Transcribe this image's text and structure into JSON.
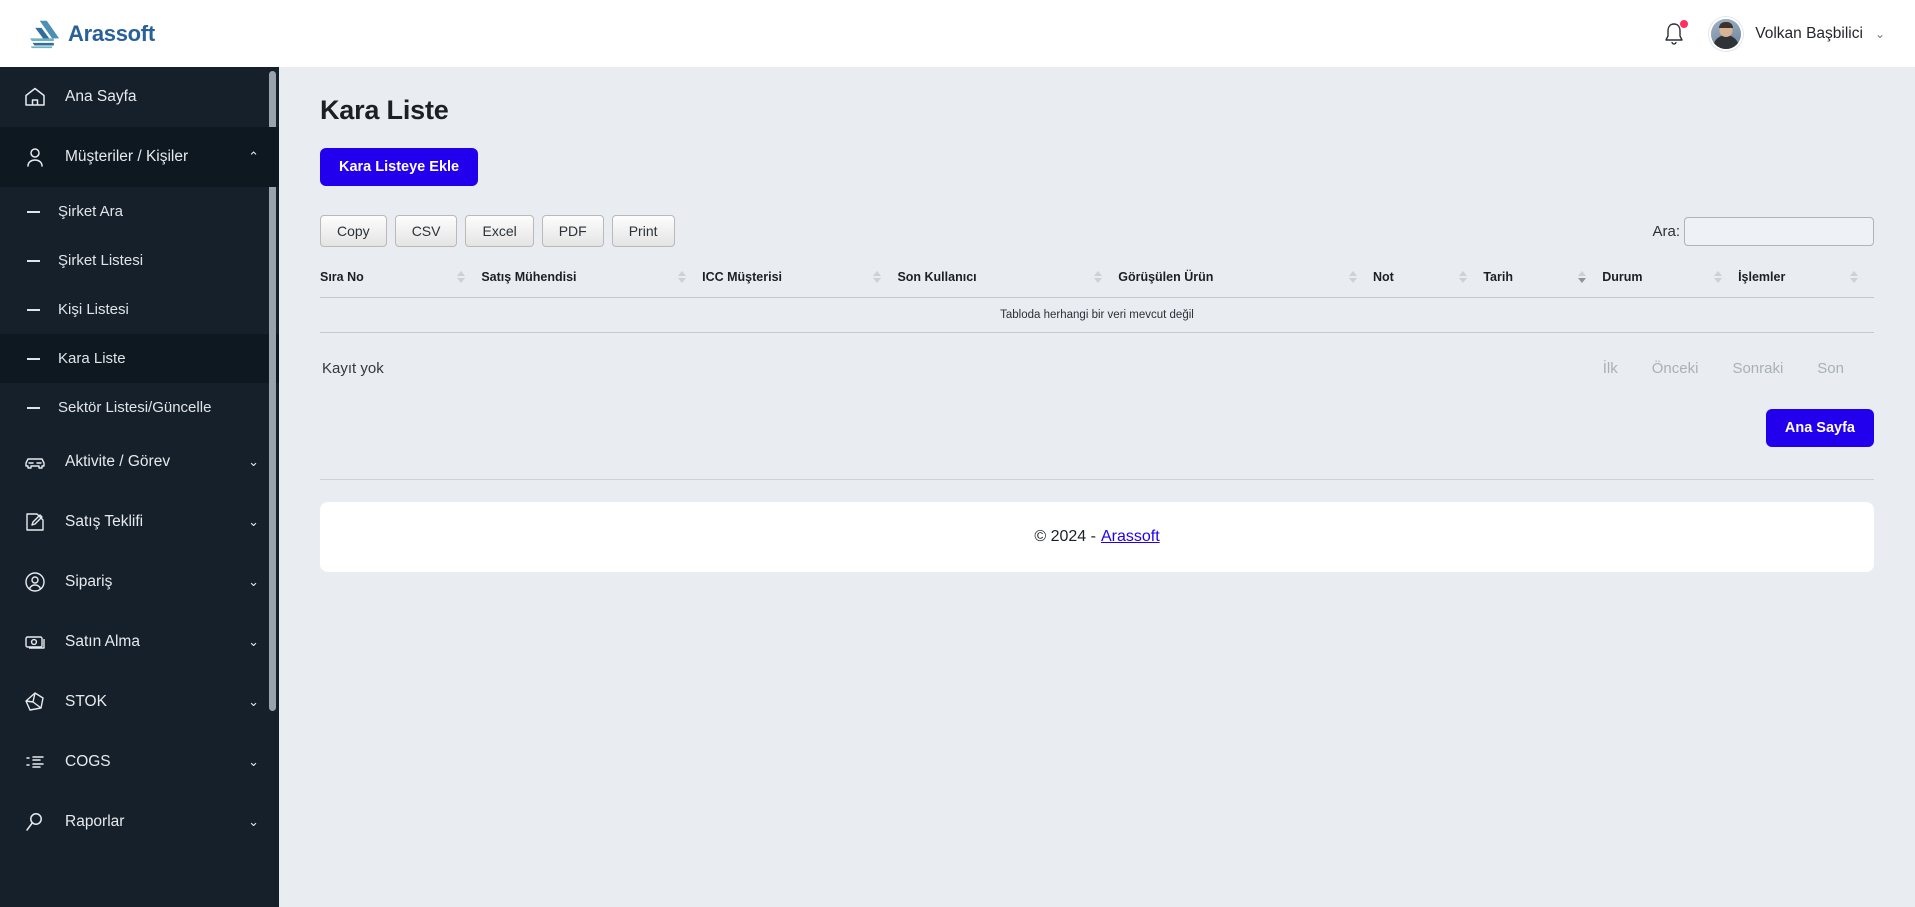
{
  "app": {
    "brand": "Arassoft",
    "accent_blue": "#2200ee",
    "sidebar_bg": "#16202a"
  },
  "topbar": {
    "notification_label": "Bildirimler",
    "user_name": "Volkan Başbilici",
    "user_chevron": "⌄"
  },
  "sidebar": {
    "items": [
      {
        "label": "Ana Sayfa",
        "icon": "home-icon",
        "chevron": "",
        "type": "link"
      },
      {
        "label": "Müşteriler / Kişiler",
        "icon": "user-icon",
        "chevron": "⌃",
        "type": "group",
        "open": true
      },
      {
        "label": "Aktivite / Görev",
        "icon": "car-icon",
        "chevron": "⌄",
        "type": "group",
        "open": false
      },
      {
        "label": "Satış Teklifi",
        "icon": "edit-square-icon",
        "chevron": "⌄",
        "type": "group",
        "open": false
      },
      {
        "label": "Sipariş",
        "icon": "user-circle-icon",
        "chevron": "⌄",
        "type": "group",
        "open": false
      },
      {
        "label": "Satın Alma",
        "icon": "banknote-icon",
        "chevron": "⌄",
        "type": "group",
        "open": false
      },
      {
        "label": "STOK",
        "icon": "cube-icon",
        "chevron": "⌄",
        "type": "group",
        "open": false
      },
      {
        "label": "COGS",
        "icon": "list-icon",
        "chevron": "⌄",
        "type": "group",
        "open": false
      },
      {
        "label": "Raporlar",
        "icon": "magnifier-icon",
        "chevron": "⌄",
        "type": "group",
        "open": false
      }
    ],
    "submenu": [
      {
        "label": "Şirket Ara",
        "active": false
      },
      {
        "label": "Şirket Listesi",
        "active": false
      },
      {
        "label": "Kişi Listesi",
        "active": false
      },
      {
        "label": "Kara Liste",
        "active": true
      },
      {
        "label": "Sektör Listesi/Güncelle",
        "active": false
      }
    ]
  },
  "main": {
    "page_title": "Kara Liste",
    "add_button": "Kara Listeye Ekle",
    "home_button": "Ana Sayfa"
  },
  "datatable": {
    "export_buttons": [
      "Copy",
      "CSV",
      "Excel",
      "PDF",
      "Print"
    ],
    "search_label": "Ara:",
    "search_value": "",
    "search_placeholder": "",
    "columns": [
      {
        "label": "Sıra No",
        "sort": "none"
      },
      {
        "label": "Satış Mühendisi",
        "sort": "none"
      },
      {
        "label": "ICC Müşterisi",
        "sort": "none"
      },
      {
        "label": "Son Kullanıcı",
        "sort": "none"
      },
      {
        "label": "Görüşülen Ürün",
        "sort": "none"
      },
      {
        "label": "Not",
        "sort": "none"
      },
      {
        "label": "Tarih",
        "sort": "desc"
      },
      {
        "label": "Durum",
        "sort": "none"
      },
      {
        "label": "İşlemler",
        "sort": "none"
      }
    ],
    "rows": [],
    "empty_message": "Tabloda herhangi bir veri mevcut değil",
    "info_text": "Kayıt yok",
    "pagination": [
      {
        "label": "İlk",
        "disabled": true
      },
      {
        "label": "Önceki",
        "disabled": true
      },
      {
        "label": "Sonraki",
        "disabled": true
      },
      {
        "label": "Son",
        "disabled": true
      }
    ]
  },
  "footer": {
    "copyright": "© 2024 -",
    "link": "Arassoft"
  }
}
